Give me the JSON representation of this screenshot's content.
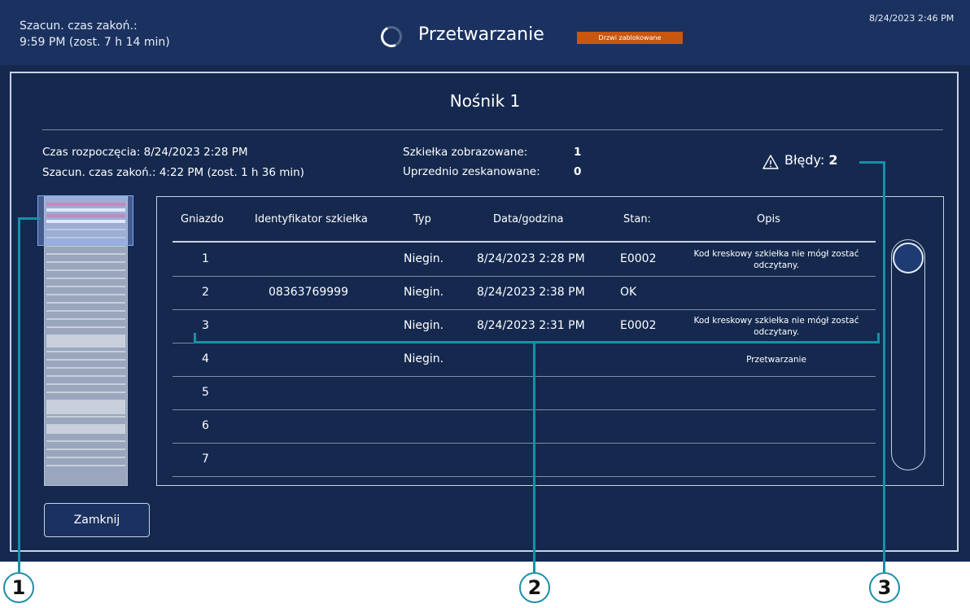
{
  "topbar": {
    "eta_label": "Szacun. czas zakoń.:",
    "eta_value": "9:59 PM (zost. 7 h 14 min)",
    "status": "Przetwarzanie",
    "door_badge": "Drzwi zablokowane",
    "datetime": "8/24/2023 2:46 PM"
  },
  "panel": {
    "title": "Nośnik 1",
    "start_label": "Czas rozpoczęcia:",
    "start_value": "8/24/2023 2:28 PM",
    "eta_label": "Szacun. czas zakoń.:",
    "eta_value": "4:22 PM (zost. 1 h 36 min)",
    "imaged_label": "Szkiełka zobrazowane:",
    "imaged_value": "1",
    "prescanned_label": "Uprzednio zeskanowane:",
    "prescanned_value": "0",
    "errors_label": "Błędy:",
    "errors_value": "2",
    "close_button": "Zamknij"
  },
  "table": {
    "headers": [
      "Gniazdo",
      "Identyfikator szkiełka",
      "Typ",
      "Data/godzina",
      "Stan:",
      "Opis"
    ],
    "rows": [
      {
        "slot": "1",
        "id": "",
        "type": "Niegin.",
        "datetime": "8/24/2023 2:28 PM",
        "status": "E0002",
        "desc": "Kod kreskowy szkiełka nie mógł zostać odczytany."
      },
      {
        "slot": "2",
        "id": "08363769999",
        "type": "Niegin.",
        "datetime": "8/24/2023 2:38 PM",
        "status": "OK",
        "desc": ""
      },
      {
        "slot": "3",
        "id": "",
        "type": "Niegin.",
        "datetime": "8/24/2023 2:31 PM",
        "status": "E0002",
        "desc": "Kod kreskowy szkiełka nie mógł zostać odczytany."
      },
      {
        "slot": "4",
        "id": "",
        "type": "Niegin.",
        "datetime": "",
        "status": "",
        "desc": "Przetwarzanie"
      },
      {
        "slot": "5",
        "id": "",
        "type": "",
        "datetime": "",
        "status": "",
        "desc": ""
      },
      {
        "slot": "6",
        "id": "",
        "type": "",
        "datetime": "",
        "status": "",
        "desc": ""
      },
      {
        "slot": "7",
        "id": "",
        "type": "",
        "datetime": "",
        "status": "",
        "desc": ""
      }
    ]
  },
  "callouts": [
    "1",
    "2",
    "3"
  ],
  "colors": {
    "background": "#15294f",
    "topbar": "#1b3260",
    "badge": "#c8570f",
    "callout": "#1a8fa6",
    "error_slot": "#d96a9a"
  }
}
